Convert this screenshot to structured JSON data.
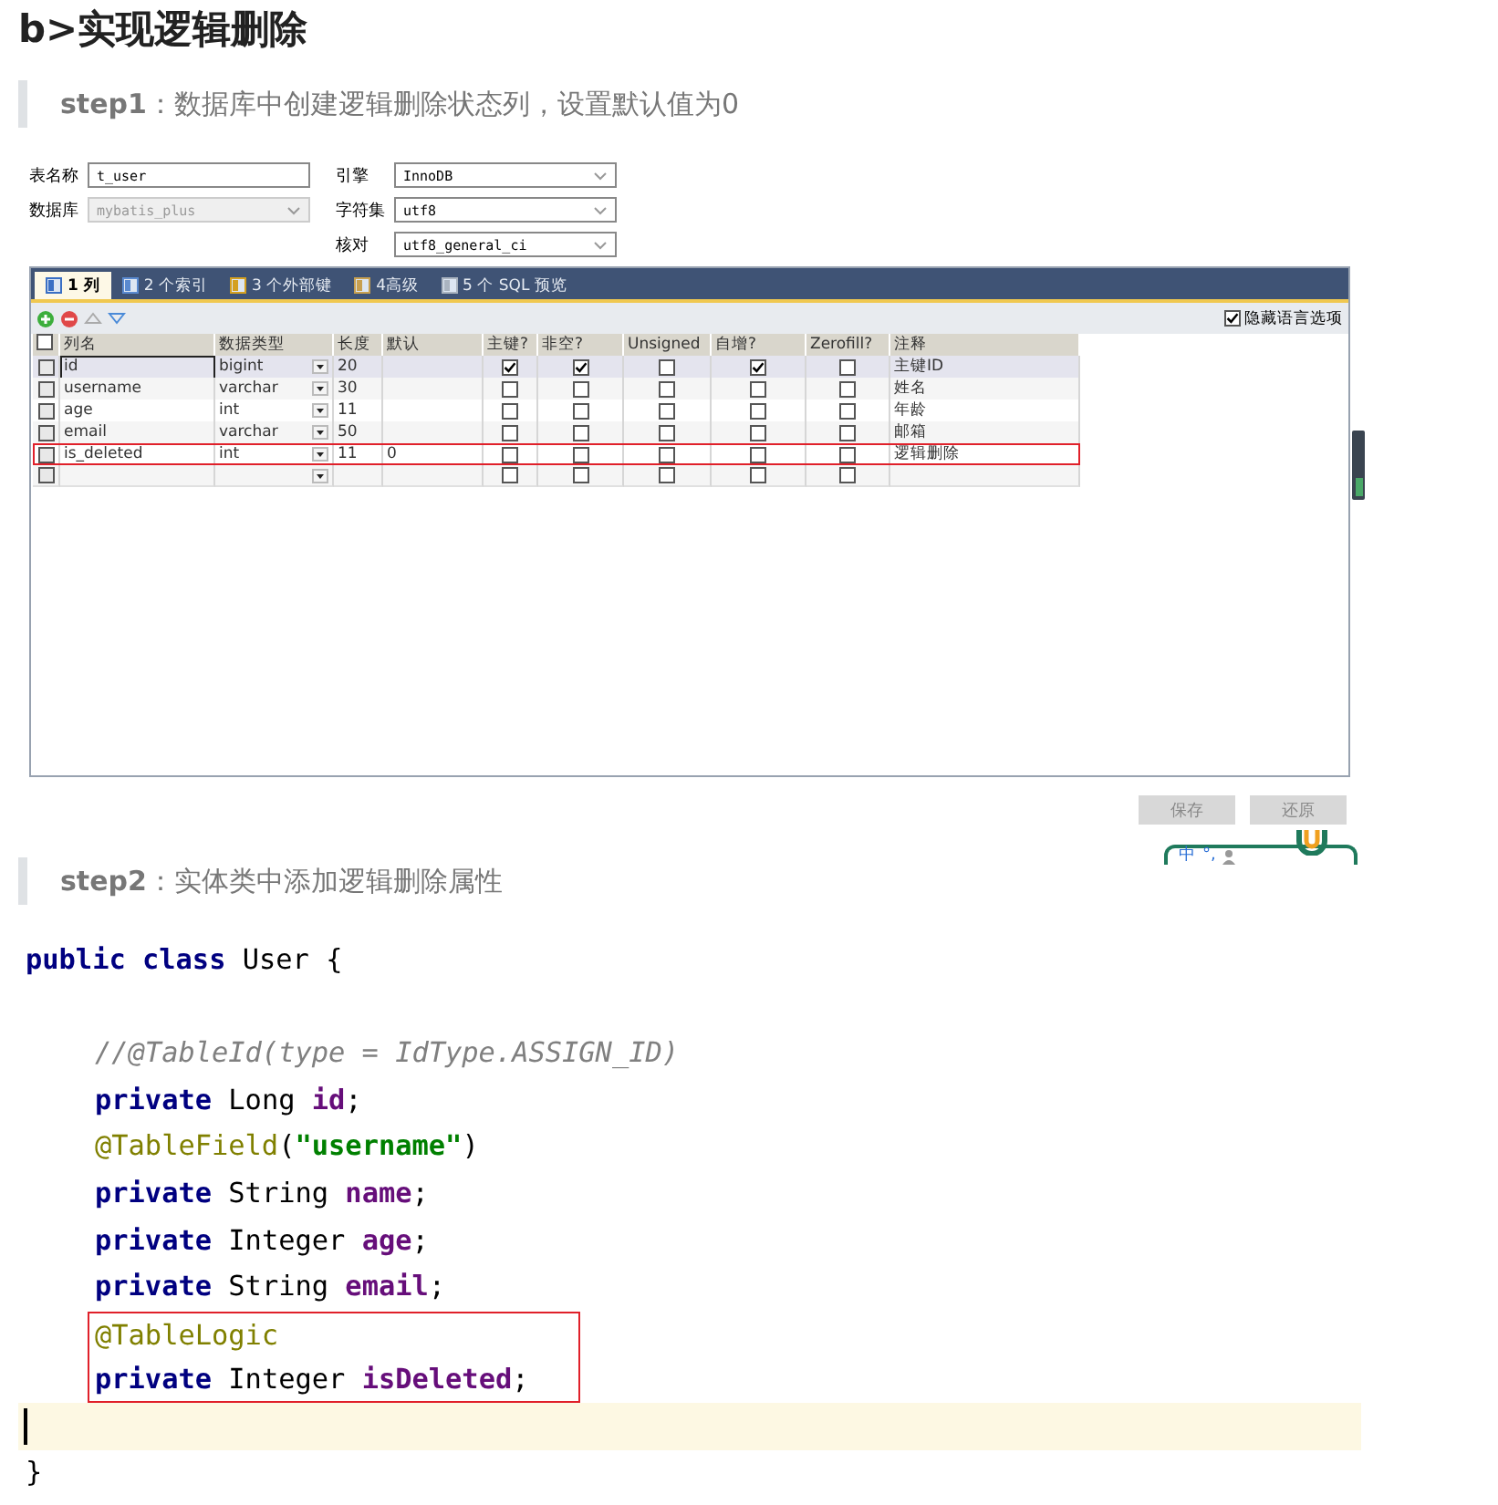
{
  "heading": "b>实现逻辑删除",
  "step1": {
    "label": "step1",
    "text": "：数据库中创建逻辑删除状态列，设置默认值为0"
  },
  "form": {
    "left": [
      {
        "label": "表名称",
        "value": "t_user",
        "disabled": false
      },
      {
        "label": "数据库",
        "value": "mybatis_plus",
        "disabled": true,
        "dropdown": true
      }
    ],
    "right": [
      {
        "label": "引擎",
        "value": "InnoDB"
      },
      {
        "label": "字符集",
        "value": "utf8"
      },
      {
        "label": "核对",
        "value": "utf8_general_ci"
      }
    ]
  },
  "tabs": [
    {
      "label": "1 列",
      "selected": true
    },
    {
      "label": "2 个索引",
      "selected": false
    },
    {
      "label": "3 个外部键",
      "selected": false
    },
    {
      "label": "4高级",
      "selected": false
    },
    {
      "label": "5 个 SQL 预览",
      "selected": false
    }
  ],
  "hide_language_options": {
    "label": "隐藏语言选项",
    "checked": true
  },
  "grid": {
    "select_all_checked": false,
    "columns": [
      "列名",
      "数据类型",
      "长度",
      "默认",
      "主键?",
      "非空?",
      "Unsigned",
      "自增?",
      "Zerofill?",
      "注释"
    ],
    "rows": [
      {
        "kind": "column",
        "name": "id",
        "type": "bigint",
        "length": "20",
        "primary_key": true,
        "not_null": true,
        "unsigned": false,
        "auto_increment": true,
        "zerofill": false,
        "comment": "主键ID",
        "selected": true,
        "boxed": false
      },
      {
        "kind": "column",
        "name": "username",
        "type": "varchar",
        "length": "30",
        "primary_key": false,
        "not_null": false,
        "unsigned": false,
        "auto_increment": false,
        "zerofill": false,
        "comment": "姓名",
        "selected": false,
        "boxed": false
      },
      {
        "kind": "column",
        "name": "age",
        "type": "int",
        "length": "11",
        "primary_key": false,
        "not_null": false,
        "unsigned": false,
        "auto_increment": false,
        "zerofill": false,
        "comment": "年龄",
        "selected": false,
        "boxed": false
      },
      {
        "kind": "column",
        "name": "email",
        "type": "varchar",
        "length": "50",
        "primary_key": false,
        "not_null": false,
        "unsigned": false,
        "auto_increment": false,
        "zerofill": false,
        "comment": "邮箱",
        "selected": false,
        "boxed": false
      },
      {
        "kind": "column",
        "name": "is_deleted",
        "type": "int",
        "length": "11",
        "default": "0",
        "primary_key": false,
        "not_null": false,
        "unsigned": false,
        "auto_increment": false,
        "zerofill": false,
        "comment": "逻辑删除",
        "selected": false,
        "boxed": true
      },
      {
        "kind": "blank",
        "primary_key": false,
        "not_null": false,
        "unsigned": false,
        "auto_increment": false,
        "zerofill": false,
        "selected": false,
        "boxed": false
      }
    ]
  },
  "buttons": [
    "保存",
    "还原"
  ],
  "ime": {
    "items": [
      "中",
      "°,"
    ]
  },
  "step2": {
    "label": "step2",
    "text": "：实体类中添加逻辑删除属性"
  },
  "code": [
    {
      "kind": "code",
      "boxed": false,
      "tokens": [
        {
          "kind": "keyword",
          "text": "public class "
        },
        {
          "kind": "plain",
          "text": "User {"
        }
      ]
    },
    {
      "kind": "blank"
    },
    {
      "kind": "code",
      "boxed": false,
      "indented": true,
      "tokens": [
        {
          "kind": "comment",
          "text": "//@TableId(type = IdType.ASSIGN_ID)"
        }
      ]
    },
    {
      "kind": "code",
      "boxed": false,
      "indented": true,
      "tokens": [
        {
          "kind": "keyword",
          "text": "private "
        },
        {
          "kind": "plain",
          "text": "Long "
        },
        {
          "kind": "field",
          "text": "id"
        },
        {
          "kind": "plain",
          "text": ";"
        }
      ]
    },
    {
      "kind": "code",
      "boxed": false,
      "indented": true,
      "tokens": [
        {
          "kind": "annotation",
          "text": "@TableField"
        },
        {
          "kind": "plain",
          "text": "("
        },
        {
          "kind": "string",
          "text": "\"username\""
        },
        {
          "kind": "plain",
          "text": ")"
        }
      ]
    },
    {
      "kind": "code",
      "boxed": false,
      "indented": true,
      "tokens": [
        {
          "kind": "keyword",
          "text": "private "
        },
        {
          "kind": "plain",
          "text": "String "
        },
        {
          "kind": "field",
          "text": "name"
        },
        {
          "kind": "plain",
          "text": ";"
        }
      ]
    },
    {
      "kind": "code",
      "boxed": false,
      "indented": true,
      "tokens": [
        {
          "kind": "keyword",
          "text": "private "
        },
        {
          "kind": "plain",
          "text": "Integer "
        },
        {
          "kind": "field",
          "text": "age"
        },
        {
          "kind": "plain",
          "text": ";"
        }
      ]
    },
    {
      "kind": "code",
      "boxed": false,
      "indented": true,
      "tokens": [
        {
          "kind": "keyword",
          "text": "private "
        },
        {
          "kind": "plain",
          "text": "String "
        },
        {
          "kind": "field",
          "text": "email"
        },
        {
          "kind": "plain",
          "text": ";"
        }
      ]
    },
    {
      "kind": "code",
      "boxed": true,
      "tokens": [
        {
          "kind": "annotation",
          "text": "@TableLogic"
        }
      ]
    },
    {
      "kind": "code",
      "boxed": true,
      "tokens": [
        {
          "kind": "keyword",
          "text": "private "
        },
        {
          "kind": "plain",
          "text": "Integer "
        },
        {
          "kind": "field",
          "text": "isDeleted"
        },
        {
          "kind": "plain",
          "text": ";"
        }
      ]
    },
    {
      "kind": "cursor"
    },
    {
      "kind": "code",
      "boxed": false,
      "tokens": [
        {
          "kind": "plain",
          "text": "}"
        }
      ]
    }
  ]
}
